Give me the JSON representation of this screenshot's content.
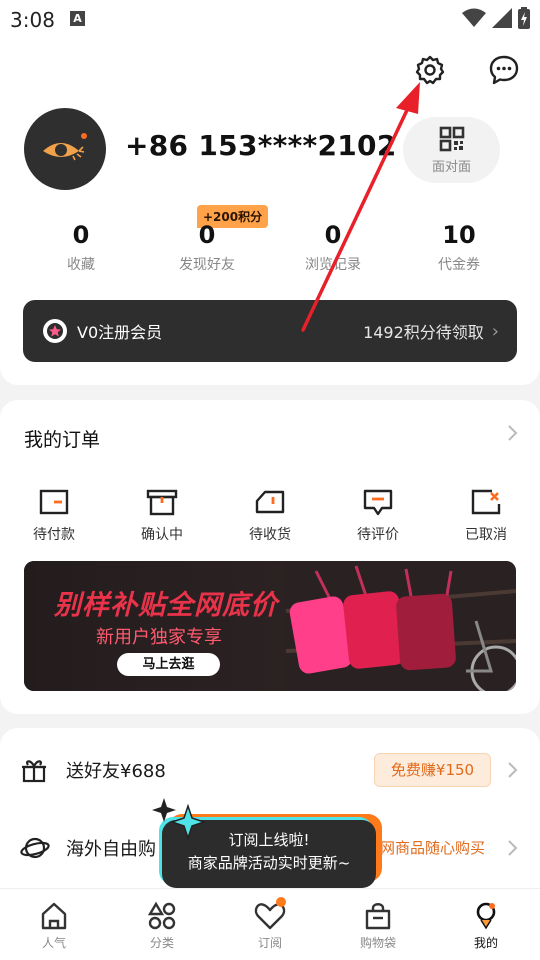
{
  "status_bar": {
    "time": "3:08",
    "notif_icon_label": "A"
  },
  "profile": {
    "phone": "+86 153****2102",
    "face_to_face_label": "面对面",
    "bonus_badge": "+200积分",
    "stats": [
      {
        "value": "0",
        "label": "收藏"
      },
      {
        "value": "0",
        "label": "发现好友"
      },
      {
        "value": "0",
        "label": "浏览记录"
      },
      {
        "value": "10",
        "label": "代金券"
      }
    ],
    "vip": {
      "label": "V0注册会员",
      "points_text": "1492积分待领取"
    }
  },
  "orders": {
    "title": "我的订单",
    "items": [
      {
        "label": "待付款",
        "icon": "wallet-icon"
      },
      {
        "label": "确认中",
        "icon": "box-icon"
      },
      {
        "label": "待收货",
        "icon": "truck-icon"
      },
      {
        "label": "待评价",
        "icon": "comment-icon"
      },
      {
        "label": "已取消",
        "icon": "cancel-order-icon"
      }
    ],
    "banner": {
      "title": "别样补贴全网底价",
      "subtitle": "新用户独家专享",
      "button": "马上去逛"
    }
  },
  "more": {
    "invite": {
      "label": "送好友¥688",
      "badge": "免费赚¥150"
    },
    "overseas": {
      "label": "海外自由购",
      "hint": "网商品随心购买"
    }
  },
  "tooltip": {
    "line1": "订阅上线啦!",
    "line2": "商家品牌活动实时更新~"
  },
  "tabs": [
    {
      "label": "人气",
      "icon": "home-icon"
    },
    {
      "label": "分类",
      "icon": "category-icon"
    },
    {
      "label": "订阅",
      "icon": "heart-icon"
    },
    {
      "label": "购物袋",
      "icon": "bag-icon"
    },
    {
      "label": "我的",
      "icon": "profile-icon"
    }
  ],
  "colors": {
    "accent": "#ff7a1a",
    "annotation_arrow": "#e8202a"
  }
}
